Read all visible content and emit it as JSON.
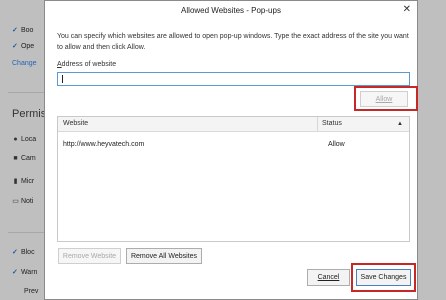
{
  "background": {
    "rows": [
      {
        "check": "✓",
        "text": "Boo"
      },
      {
        "check": "✓",
        "text": "Ope"
      },
      {
        "text": "Change"
      }
    ],
    "permissions_title": "Permis",
    "perm_items": [
      "Loca",
      "Cam",
      "Micr",
      "Noti"
    ],
    "bottom_rows": [
      {
        "check": "✓",
        "text": "Bloc"
      },
      {
        "check": "✓",
        "text": "Warn"
      },
      {
        "text": "Prev"
      }
    ]
  },
  "dialog": {
    "title": "Allowed Websites - Pop-ups",
    "close_glyph": "✕",
    "description": "You can specify which websites are allowed to open pop-up windows. Type the exact address of the site you want to allow and then click Allow.",
    "address_label_accesskey": "A",
    "address_label_rest": "ddress of website",
    "address_value": "",
    "allow_button": "Allow",
    "table": {
      "columns": [
        "Website",
        "Status"
      ],
      "sort_glyph": "▲",
      "rows": [
        {
          "website": "http://www.heyvatech.com",
          "status": "Allow"
        }
      ]
    },
    "remove_website_button": "Remove Website",
    "remove_all_button": "Remove All Websites",
    "cancel_button": "Cancel",
    "save_button": "Save Changes"
  },
  "colors": {
    "highlight": "#c62828",
    "input_border": "#5b9bd5"
  }
}
